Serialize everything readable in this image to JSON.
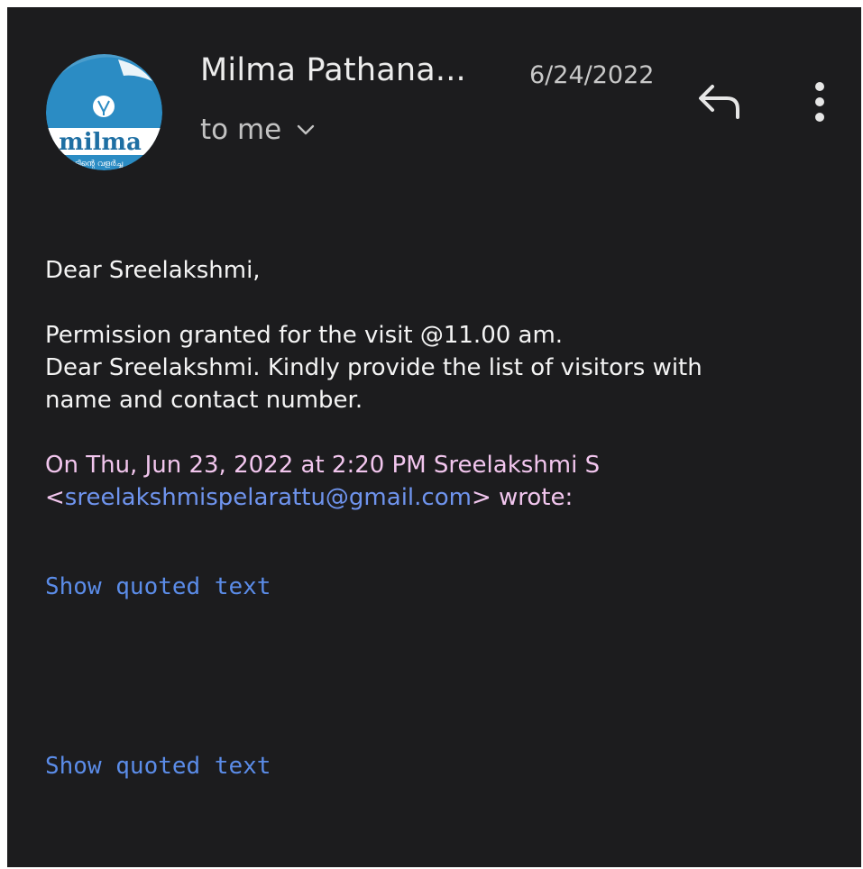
{
  "email": {
    "sender_name": "Milma Pathana...",
    "date": "6/24/2022",
    "recipient_label": "to me",
    "avatar": {
      "brand_text": "milma",
      "script_text": "നാടിന്റെ വളർച്ച",
      "background_color": "#2b8cc4"
    },
    "icons": {
      "reply": "reply-icon",
      "more": "more-vert-icon",
      "expand": "chevron-down-icon"
    },
    "body": {
      "greeting": "Dear Sreelakshmi,",
      "line1": "Permission granted for the visit @11.00 am.",
      "line2": "Dear Sreelakshmi. Kindly provide the list of visitors with",
      "line3": "name and contact number."
    },
    "quote": {
      "header_line1": "On Thu, Jun 23, 2022 at 2:20 PM Sreelakshmi S",
      "open_bracket": "<",
      "email_address": "sreelakshmispelarattu@gmail.com",
      "close_wrote": "> wrote:"
    },
    "show_quoted_labels": [
      "Show quoted text",
      "Show quoted text"
    ]
  },
  "colors": {
    "background": "#1c1c1e",
    "text_primary": "#f4f4f4",
    "quote_header": "#f2c6ee",
    "link": "#5b8ce8"
  }
}
